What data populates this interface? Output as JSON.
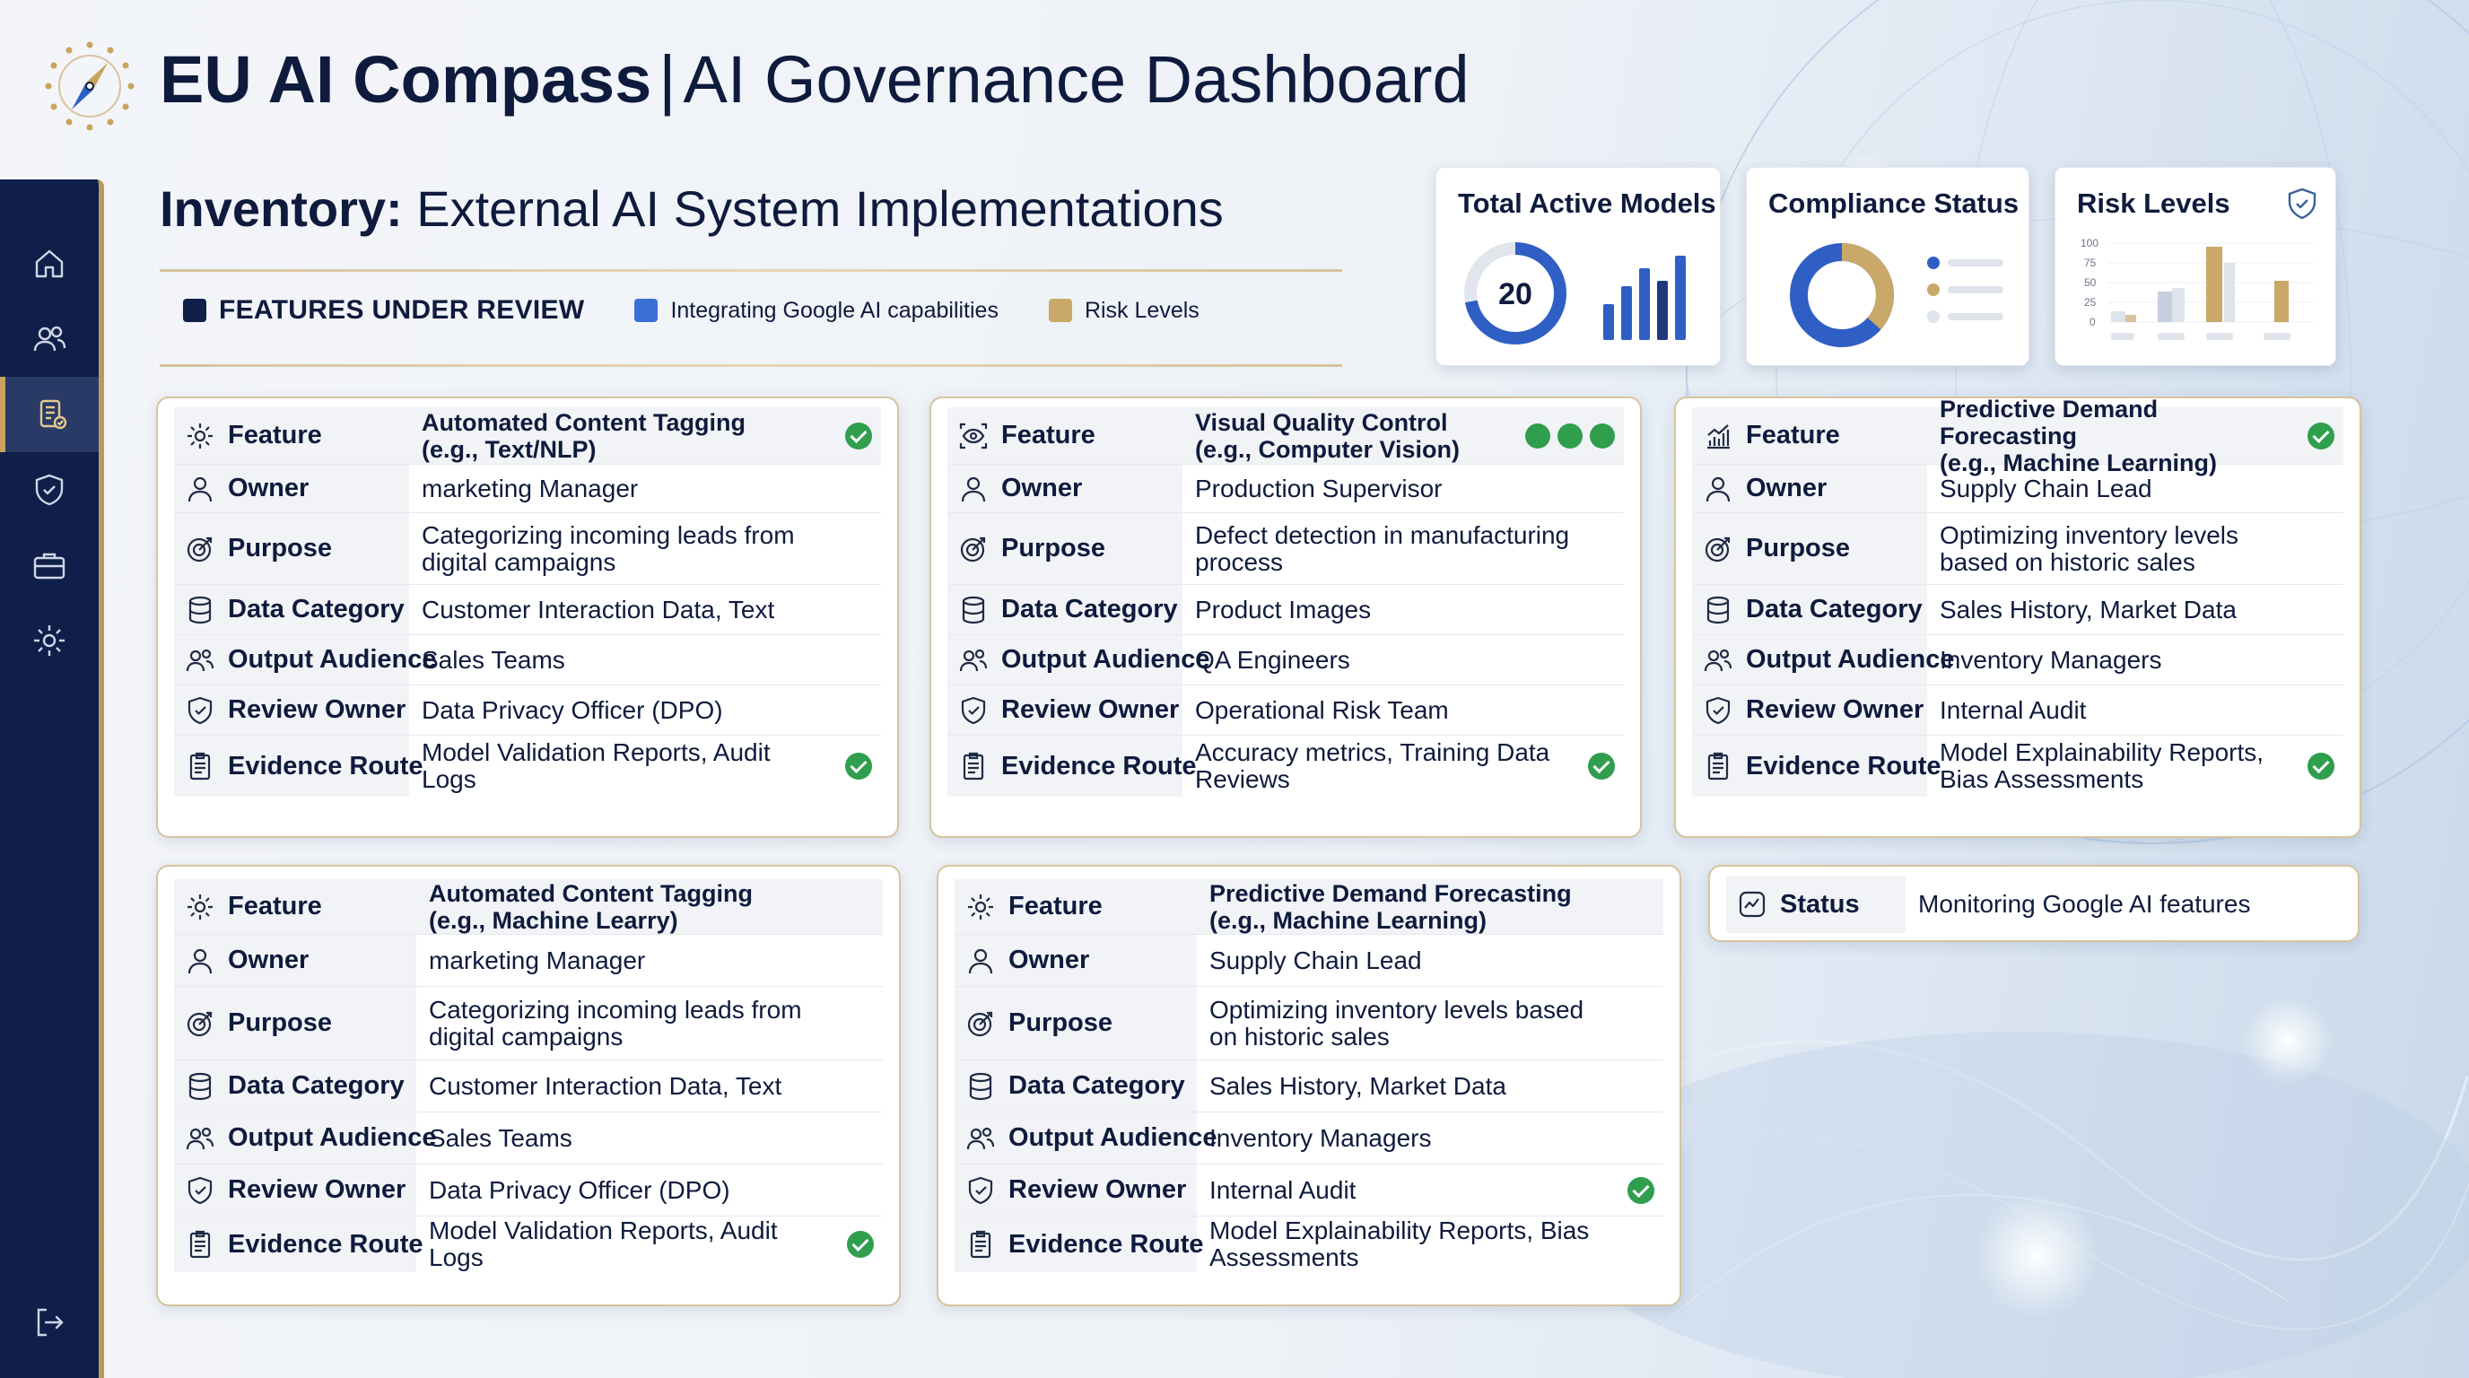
{
  "header": {
    "title_bold": "EU AI Compass",
    "separator": "|",
    "title_rest": "AI Governance Dashboard"
  },
  "page": {
    "title_bold": "Inventory:",
    "title_rest": "External AI System Implementations"
  },
  "legend": [
    {
      "label": "FEATURES UNDER REVIEW",
      "color": "#0f1f4a"
    },
    {
      "label": "Integrating Google AI capabilities",
      "color": "#3b6fd6"
    },
    {
      "label": "Risk Levels",
      "color": "#c9a86a"
    }
  ],
  "sidebar": {
    "items": [
      {
        "icon": "home-icon"
      },
      {
        "icon": "users-icon"
      },
      {
        "icon": "inventory-icon",
        "active": true
      },
      {
        "icon": "shield-icon"
      },
      {
        "icon": "briefcase-icon"
      },
      {
        "icon": "gear-icon"
      }
    ],
    "logout_icon": "logout-icon"
  },
  "kpis": {
    "total_models": {
      "title": "Total Active Models",
      "value": "20",
      "ring_fraction": 0.72
    },
    "compliance": {
      "title": "Compliance Status"
    },
    "risk": {
      "title": "Risk Levels",
      "ticks": [
        "100",
        "75",
        "50",
        "25",
        "0"
      ]
    }
  },
  "labels": {
    "feature": "Feature",
    "owner": "Owner",
    "purpose": "Purpose",
    "data_category": "Data Category",
    "output_audience": "Output Audience",
    "review_owner": "Review Owner",
    "evidence_route": "Evidence Route",
    "status": "Status"
  },
  "cards": [
    {
      "feature_l1": "Automated Content Tagging",
      "feature_l2": "(e.g., Text/NLP)",
      "owner": "marketing Manager",
      "purpose": "Categorizing incoming leads from digital campaigns",
      "data_category": "Customer Interaction Data, Text",
      "output_audience": "Sales Teams",
      "review_owner": "Data Privacy Officer (DPO)",
      "evidence_route": "Model Validation Reports, Audit Logs"
    },
    {
      "feature_l1": "Visual Quality Control",
      "feature_l2": "(e.g., Computer Vision)",
      "owner": "Production Supervisor",
      "purpose": "Defect detection in manufacturing process",
      "data_category": "Product Images",
      "output_audience": "QA Engineers",
      "review_owner": "Operational Risk Team",
      "evidence_route": "Accuracy metrics, Training Data Reviews"
    },
    {
      "feature_l1": "Predictive Demand Forecasting",
      "feature_l2": "(e.g., Machine Learning)",
      "owner": "Supply Chain Lead",
      "purpose": "Optimizing inventory levels based on historic sales",
      "data_category": "Sales History, Market Data",
      "output_audience": "Inventory Managers",
      "review_owner": "Internal Audit",
      "evidence_route": "Model Explainability Reports, Bias Assessments"
    },
    {
      "feature_l1": "Automated Content Tagging",
      "feature_l2": "(e.g., Machine Learry)",
      "owner": "marketing Manager",
      "purpose": "Categorizing incoming leads from digital campaigns",
      "data_category": "Customer Interaction Data, Text",
      "output_audience": "Sales Teams",
      "review_owner": "Data Privacy Officer (DPO)",
      "evidence_route": "Model Validation Reports, Audit Logs"
    },
    {
      "feature_l1": "Predictive Demand Forecasting",
      "feature_l2": "(e.g., Machine Learning)",
      "owner": "Supply Chain Lead",
      "purpose": "Optimizing inventory levels based on historic sales",
      "data_category": "Sales History, Market Data",
      "output_audience": "Inventory Managers",
      "review_owner": "Internal Audit",
      "evidence_route": "Model Explainability Reports, Bias Assessments"
    }
  ],
  "status_card": {
    "value": "Monitoring Google AI features"
  }
}
